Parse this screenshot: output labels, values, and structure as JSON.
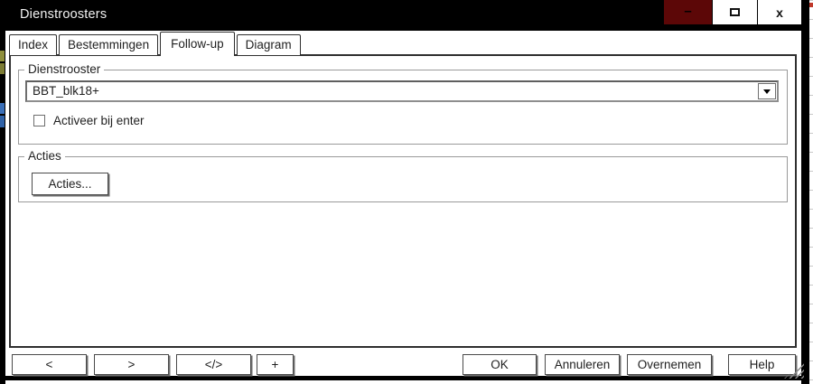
{
  "window": {
    "title": "Dienstroosters",
    "controls": {
      "minimize_glyph": "–",
      "maximize_icon": "square-outline",
      "close_glyph": "x"
    }
  },
  "tabs": [
    {
      "label": "Index",
      "active": false
    },
    {
      "label": "Bestemmingen",
      "active": false
    },
    {
      "label": "Follow-up",
      "active": true
    },
    {
      "label": "Diagram",
      "active": false
    }
  ],
  "dienstrooster_group": {
    "label": "Dienstrooster",
    "combo_value": "BBT_blk18+",
    "combo_icon": "chevron-down-icon",
    "checkbox_label": "Activeer bij enter",
    "checkbox_checked": false
  },
  "acties_group": {
    "label": "Acties",
    "button_label": "Acties..."
  },
  "footer": {
    "nav_buttons": [
      "<",
      ">",
      "</>",
      "+"
    ],
    "ok": "OK",
    "annuleren": "Annuleren",
    "overnemen": "Overnemen",
    "help": "Help"
  },
  "colors": {
    "titlebar_bg": "#000000",
    "titlebar_text": "#f2f2f2",
    "minimize_bg": "#5c0707",
    "panel_border": "#2f2f2f",
    "group_border": "#9a9a9a"
  }
}
